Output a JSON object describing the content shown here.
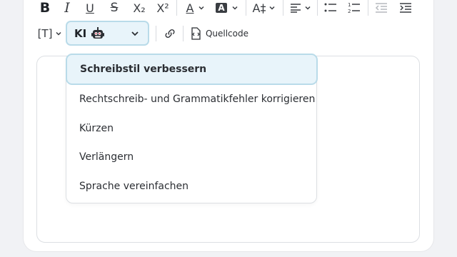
{
  "toolbar": {
    "row1": {
      "bold": "B",
      "italic": "I",
      "underline": "U",
      "strike": "S",
      "subscript": "X₂",
      "superscript": "X²",
      "font_color": "A",
      "highlight": "A",
      "font_size": "A‡"
    },
    "row2": {
      "placeholder_tag": "[T]",
      "ai_select_label": "KI",
      "source_label": "Quellcode"
    }
  },
  "ai_menu": {
    "items": [
      "Schreibstil verbessern",
      "Rechtschreib- und Grammatikfehler korrigieren",
      "Kürzen",
      "Verlängern",
      "Sprache vereinfachen"
    ],
    "selected_index": 0
  },
  "colors": {
    "accent_bg": "#e8f4fa",
    "accent_border": "#b9dbe9",
    "page_bg": "#f1f2f5"
  }
}
